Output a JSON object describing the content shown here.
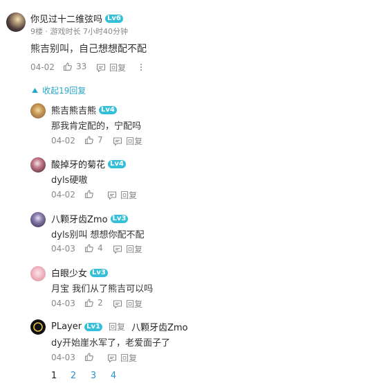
{
  "colors": {
    "accent": "#29a8c8",
    "level_badge": "#35bfd9",
    "meta": "#888888"
  },
  "main_comment": {
    "username": "你见过十二维弦吗",
    "level": "Lv6",
    "floor_info": "9楼 · 游戏时长 7小时40分钟",
    "text": "熊吉别叫，自己想想配不配",
    "date": "04-02",
    "likes": "33",
    "reply_label": "回复",
    "more_icon": "more-vertical-icon"
  },
  "collapse_label": "收起19回复",
  "replies": [
    {
      "username": "熊吉熊吉熊",
      "level": "Lv4",
      "text": "那我肯定配的，宁配吗",
      "date": "04-02",
      "likes": "7",
      "reply_label": "回复"
    },
    {
      "username": "酸掉牙的菊花",
      "level": "Lv4",
      "text": "dyls硬嗷",
      "date": "04-02",
      "likes": "",
      "reply_label": "回复"
    },
    {
      "username": "八颗牙齿Zmo",
      "level": "Lv3",
      "text": "dyls别叫 想想你配不配",
      "date": "04-03",
      "likes": "4",
      "reply_label": "回复"
    },
    {
      "username": "白眼少女",
      "level": "Lv3",
      "text": "月宝 我们从了熊吉可以吗",
      "date": "04-03",
      "likes": "2",
      "reply_label": "回复"
    },
    {
      "username": "PLayer",
      "level": "Lv1",
      "reply_to_prefix": "回复",
      "reply_to": "八颗牙齿Zmo",
      "text": "dy开始崖水军了，老爱面子了",
      "date": "04-03",
      "likes": "",
      "reply_label": "回复"
    }
  ],
  "pagination": {
    "pages": [
      "1",
      "2",
      "3",
      "4"
    ],
    "current": "1"
  }
}
